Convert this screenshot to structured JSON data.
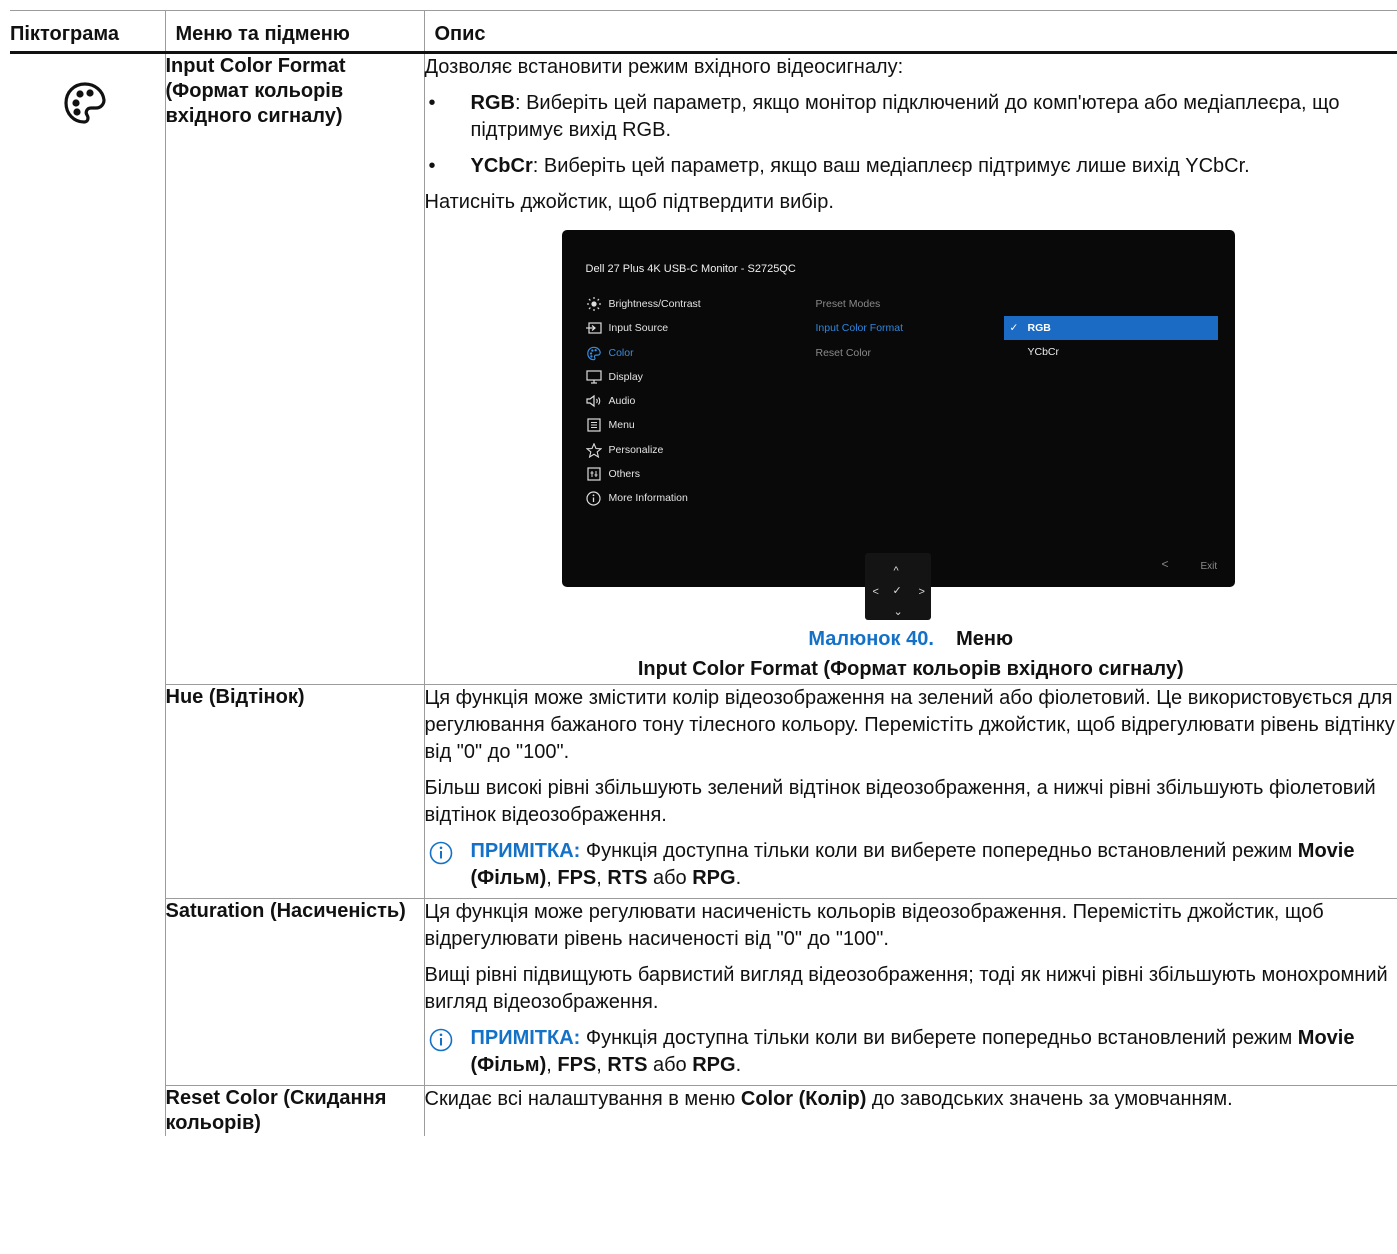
{
  "headers": {
    "icon": "Піктограма",
    "menu": "Меню та підменю",
    "desc": "Опис"
  },
  "icon_name": "color-palette-icon",
  "input_color_format": {
    "name": "Input Color Format (Формат кольорів вхідного сигналу)",
    "intro": "Дозволяє встановити режим вхідного відеосигналу:",
    "rgb_term": "RGB",
    "rgb_text": ": Виберіть цей параметр, якщо монітор підключений до комп'ютера або медіаплеєра, що підтримує вихід RGB.",
    "ycbcr_term": "YCbCr",
    "ycbcr_text": ": Виберіть цей параметр, якщо ваш медіаплеєр підтримує лише вихід YCbCr.",
    "confirm": "Натисніть джойстик, щоб підтвердити вибір."
  },
  "osd": {
    "title": "Dell 27 Plus 4K USB-C Monitor - S2725QC",
    "menu": [
      {
        "label": "Brightness/Contrast",
        "icon": "brightness-icon",
        "active": false
      },
      {
        "label": "Input Source",
        "icon": "input-source-icon",
        "active": false
      },
      {
        "label": "Color",
        "icon": "color-palette-icon",
        "active": true
      },
      {
        "label": "Display",
        "icon": "display-icon",
        "active": false
      },
      {
        "label": "Audio",
        "icon": "audio-icon",
        "active": false
      },
      {
        "label": "Menu",
        "icon": "menu-icon",
        "active": false
      },
      {
        "label": "Personalize",
        "icon": "star-icon",
        "active": false
      },
      {
        "label": "Others",
        "icon": "others-icon",
        "active": false
      },
      {
        "label": "More Information",
        "icon": "info-icon",
        "active": false
      }
    ],
    "submenu": [
      "Preset Modes",
      "Input Color Format",
      "Reset Color"
    ],
    "options": [
      "RGB",
      "YCbCr"
    ],
    "selected_option": "RGB",
    "check_mark": "✓",
    "back_symbol": "<",
    "exit": "Exit",
    "joystick": {
      "up": "^",
      "down": "⌄",
      "left": "<",
      "right": ">",
      "center": "✓"
    }
  },
  "caption": {
    "number": "Малюнок 40.",
    "title_part": "Меню",
    "subtitle": "Input Color Format (Формат кольорів вхідного сигналу)"
  },
  "hue": {
    "name": "Hue (Відтінок)",
    "p1": "Ця функція може змістити колір відеозображення на зелений або фіолетовий. Це використовується для регулювання бажаного тону тілесного кольору. Перемістіть джойстик, щоб відрегулювати рівень відтінку від \"0\" до \"100\".",
    "p2": "Більш високі рівні збільшують зелений відтінок відеозображення, а нижчі рівні збільшують фіолетовий відтінок відеозображення."
  },
  "note": {
    "label": "ПРИМІТКА:",
    "text1": " Функція доступна тільки коли ви виберете попередньо встановлений режим ",
    "movie": "Movie (Фільм)",
    "sep1": ", ",
    "fps": "FPS",
    "sep2": ", ",
    "rts": "RTS",
    "or": " або ",
    "rpg": "RPG",
    "end": "."
  },
  "saturation": {
    "name": "Saturation (Насиченість)",
    "p1": "Ця функція може регулювати насиченість кольорів відеозображення. Перемістіть джойстик, щоб відрегулювати рівень насиченості від \"0\" до \"100\".",
    "p2": "Вищі рівні підвищують барвистий вигляд відеозображення; тоді як нижчі рівні збільшують монохромний вигляд відеозображення."
  },
  "reset_color": {
    "name": "Reset Color (Скидання кольорів)",
    "text_pre": "Скидає всі налаштування в меню ",
    "menu_bold": "Color (Колір)",
    "text_post": " до заводських значень за умовчанням."
  }
}
